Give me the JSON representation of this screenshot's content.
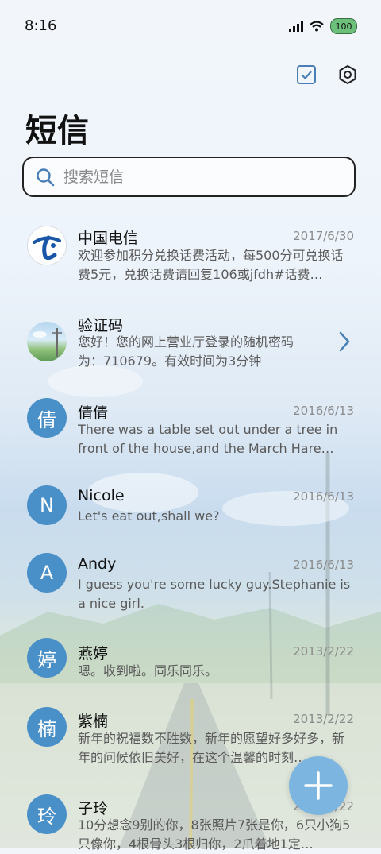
{
  "status_bar": {
    "time": "8:16",
    "battery": "100"
  },
  "header": {
    "title": "短信"
  },
  "search": {
    "placeholder": "搜索短信"
  },
  "conversations": [
    {
      "avatar_type": "logo",
      "name": "中国电信",
      "date": "2017/6/30",
      "preview": "欢迎参加积分兑换话费活动，每500分可兑换话费5元，兑换话费请回复106或jfdh#话费…"
    },
    {
      "avatar_type": "image",
      "name": "验证码",
      "date": "",
      "preview": "您好！您的网上营业厅登录的随机密码为：710679。有效时间为3分钟"
    },
    {
      "avatar_letter": "倩",
      "name": "倩倩",
      "date": "2016/6/13",
      "preview": "There was a table set out under a tree in front of the house,and the March Hare an…"
    },
    {
      "avatar_letter": "N",
      "name": "Nicole",
      "date": "2016/6/13",
      "preview": "Let's eat out,shall we?"
    },
    {
      "avatar_letter": "A",
      "name": "Andy",
      "date": "2016/6/13",
      "preview": "I guess you're some lucky guy.Stephanie is a nice girl."
    },
    {
      "avatar_letter": "婷",
      "name": "燕婷",
      "date": "2013/2/22",
      "preview": "嗯。收到啦。同乐同乐。"
    },
    {
      "avatar_letter": "楠",
      "name": "紫楠",
      "date": "2013/2/22",
      "preview": "新年的祝福数不胜数，新年的愿望好多好多，新年的问候依旧美好，在这个温馨的时刻…"
    },
    {
      "avatar_letter": "玲",
      "name": "子玲",
      "date": "2013/2/22",
      "preview": "10分想念9别的你，8张照片7张是你，6只小狗5只像你，4根骨头3根归你，2爪着地1定…"
    }
  ],
  "colors": {
    "avatar": "#4a90c8",
    "fab": "#7cb6e0",
    "accent": "#4a7fb5"
  },
  "icons": {
    "select": "checkbox-icon",
    "settings": "settings-icon",
    "search": "search-icon",
    "compose": "plus-icon",
    "open": "chevron-right-icon"
  }
}
